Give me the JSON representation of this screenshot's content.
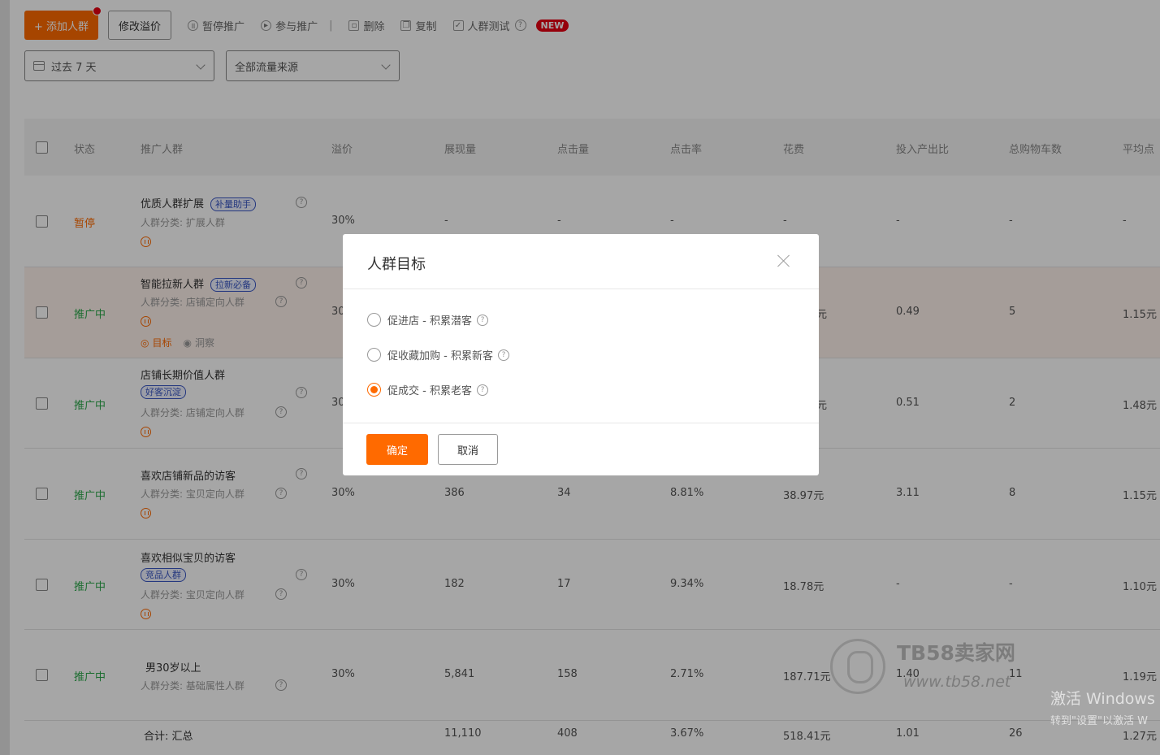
{
  "toolbar": {
    "add_label": "+ 添加人群",
    "modify_bid_label": "修改溢价",
    "pause_label": "暂停推广",
    "join_label": "参与推广",
    "separator": "|",
    "delete_label": "删除",
    "copy_label": "复制",
    "test_label": "人群测试",
    "new_badge": "NEW"
  },
  "filters": {
    "date": "过去 7 天",
    "source": "全部流量来源"
  },
  "table": {
    "headers": [
      "状态",
      "推广人群",
      "溢价",
      "展现量",
      "点击量",
      "点击率",
      "花费",
      "投入产出比",
      "总购物车数",
      "平均点"
    ],
    "rows": [
      {
        "status": "暂停",
        "name": "优质人群扩展",
        "tag": "补量助手",
        "category": "人群分类:  扩展人群",
        "premium": "30%",
        "impressions": "-",
        "clicks": "-",
        "ctr": "-",
        "cost": "-",
        "roi": "-",
        "cart": "-",
        "avg": "-"
      },
      {
        "status": "推广中",
        "name": "智能拉新人群",
        "tag": "拉新必备",
        "category": "人群分类:  店铺定向人群",
        "premium": "30",
        "cost": "元",
        "roi": "0.49",
        "cart": "5",
        "avg": "1.15元",
        "link_target": "目标",
        "link_insight": "洞察"
      },
      {
        "status": "推广中",
        "name": "店铺长期价值人群",
        "tag": "好客沉淀",
        "category": "人群分类:  店铺定向人群",
        "premium": "30",
        "cost": "元",
        "roi": "0.51",
        "cart": "2",
        "avg": "1.48元"
      },
      {
        "status": "推广中",
        "name": "喜欢店铺新品的访客",
        "category": "人群分类:  宝贝定向人群",
        "premium": "30%",
        "impressions": "386",
        "clicks": "34",
        "ctr": "8.81%",
        "cost": "38.97元",
        "roi": "3.11",
        "cart": "8",
        "avg": "1.15元"
      },
      {
        "status": "推广中",
        "name": "喜欢相似宝贝的访客",
        "tag": "竞品人群",
        "category": "人群分类:  宝贝定向人群",
        "premium": "30%",
        "impressions": "182",
        "clicks": "17",
        "ctr": "9.34%",
        "cost": "18.78元",
        "roi": "-",
        "cart": "-",
        "avg": "1.10元"
      },
      {
        "status": "推广中",
        "name": "男30岁以上",
        "category": "人群分类:  基础属性人群",
        "premium": "30%",
        "impressions": "5,841",
        "clicks": "158",
        "ctr": "2.71%",
        "cost": "187.71元",
        "roi": "1.40",
        "cart": "11",
        "avg": "1.19元"
      }
    ],
    "total": {
      "label": "合计: 汇总",
      "impressions": "11,110",
      "clicks": "408",
      "ctr": "3.67%",
      "cost": "518.41元",
      "roi": "1.01",
      "cart": "26",
      "avg": "1.27元"
    }
  },
  "modal": {
    "title": "人群目标",
    "options": [
      "促进店 - 积累潜客",
      "促收藏加购 - 积累新客",
      "促成交 - 积累老客"
    ],
    "selected_index": 2,
    "confirm_label": "确定",
    "cancel_label": "取消"
  },
  "watermark": {
    "brand": "TB58卖家网",
    "url": "www.tb58.net"
  },
  "windows_activation": {
    "line1": "激活 Windows",
    "line2": "转到\"设置\"以激活 W"
  },
  "colors": {
    "accent": "#ff6a00",
    "active": "#2ba84a",
    "tag": "#3a57c4"
  }
}
